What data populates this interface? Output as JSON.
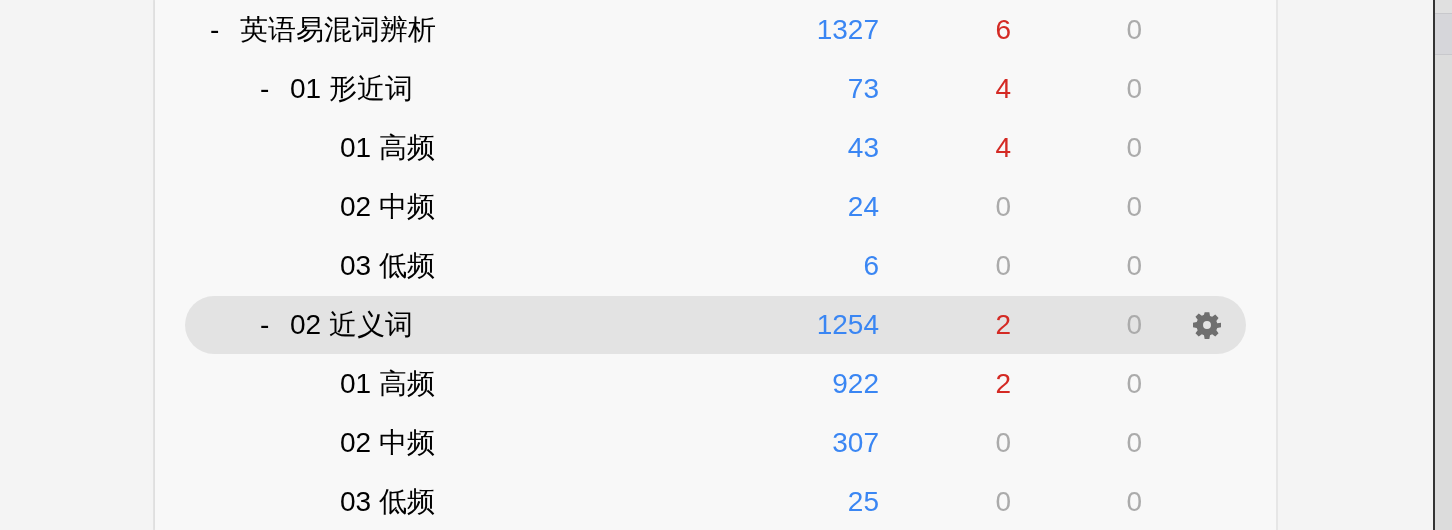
{
  "deck_tree": [
    {
      "toggle": "-",
      "name": "英语易混词辨析",
      "selected": false,
      "count_1": {
        "value": "1327",
        "dimmed": false
      },
      "count_2": {
        "value": "6",
        "dimmed": false
      },
      "count_3": {
        "value": "0",
        "dimmed": true
      },
      "children": [
        {
          "toggle": "-",
          "name": "01 形近词",
          "selected": false,
          "count_1": {
            "value": "73",
            "dimmed": false
          },
          "count_2": {
            "value": "4",
            "dimmed": false
          },
          "count_3": {
            "value": "0",
            "dimmed": true
          },
          "children": [
            {
              "name": "01 高频",
              "selected": false,
              "count_1": {
                "value": "43",
                "dimmed": false
              },
              "count_2": {
                "value": "4",
                "dimmed": false
              },
              "count_3": {
                "value": "0",
                "dimmed": true
              }
            },
            {
              "name": "02 中频",
              "selected": false,
              "count_1": {
                "value": "24",
                "dimmed": false
              },
              "count_2": {
                "value": "0",
                "dimmed": true
              },
              "count_3": {
                "value": "0",
                "dimmed": true
              }
            },
            {
              "name": "03 低频",
              "selected": false,
              "count_1": {
                "value": "6",
                "dimmed": false
              },
              "count_2": {
                "value": "0",
                "dimmed": true
              },
              "count_3": {
                "value": "0",
                "dimmed": true
              }
            }
          ]
        },
        {
          "toggle": "-",
          "name": "02 近义词",
          "selected": true,
          "count_1": {
            "value": "1254",
            "dimmed": false
          },
          "count_2": {
            "value": "2",
            "dimmed": false
          },
          "count_3": {
            "value": "0",
            "dimmed": true
          },
          "children": [
            {
              "name": "01 高频",
              "selected": false,
              "count_1": {
                "value": "922",
                "dimmed": false
              },
              "count_2": {
                "value": "2",
                "dimmed": false
              },
              "count_3": {
                "value": "0",
                "dimmed": true
              }
            },
            {
              "name": "02 中频",
              "selected": false,
              "count_1": {
                "value": "307",
                "dimmed": false
              },
              "count_2": {
                "value": "0",
                "dimmed": true
              },
              "count_3": {
                "value": "0",
                "dimmed": true
              }
            },
            {
              "name": "03 低频",
              "selected": false,
              "count_1": {
                "value": "25",
                "dimmed": false
              },
              "count_2": {
                "value": "0",
                "dimmed": true
              },
              "count_3": {
                "value": "0",
                "dimmed": true
              }
            }
          ]
        }
      ]
    }
  ]
}
